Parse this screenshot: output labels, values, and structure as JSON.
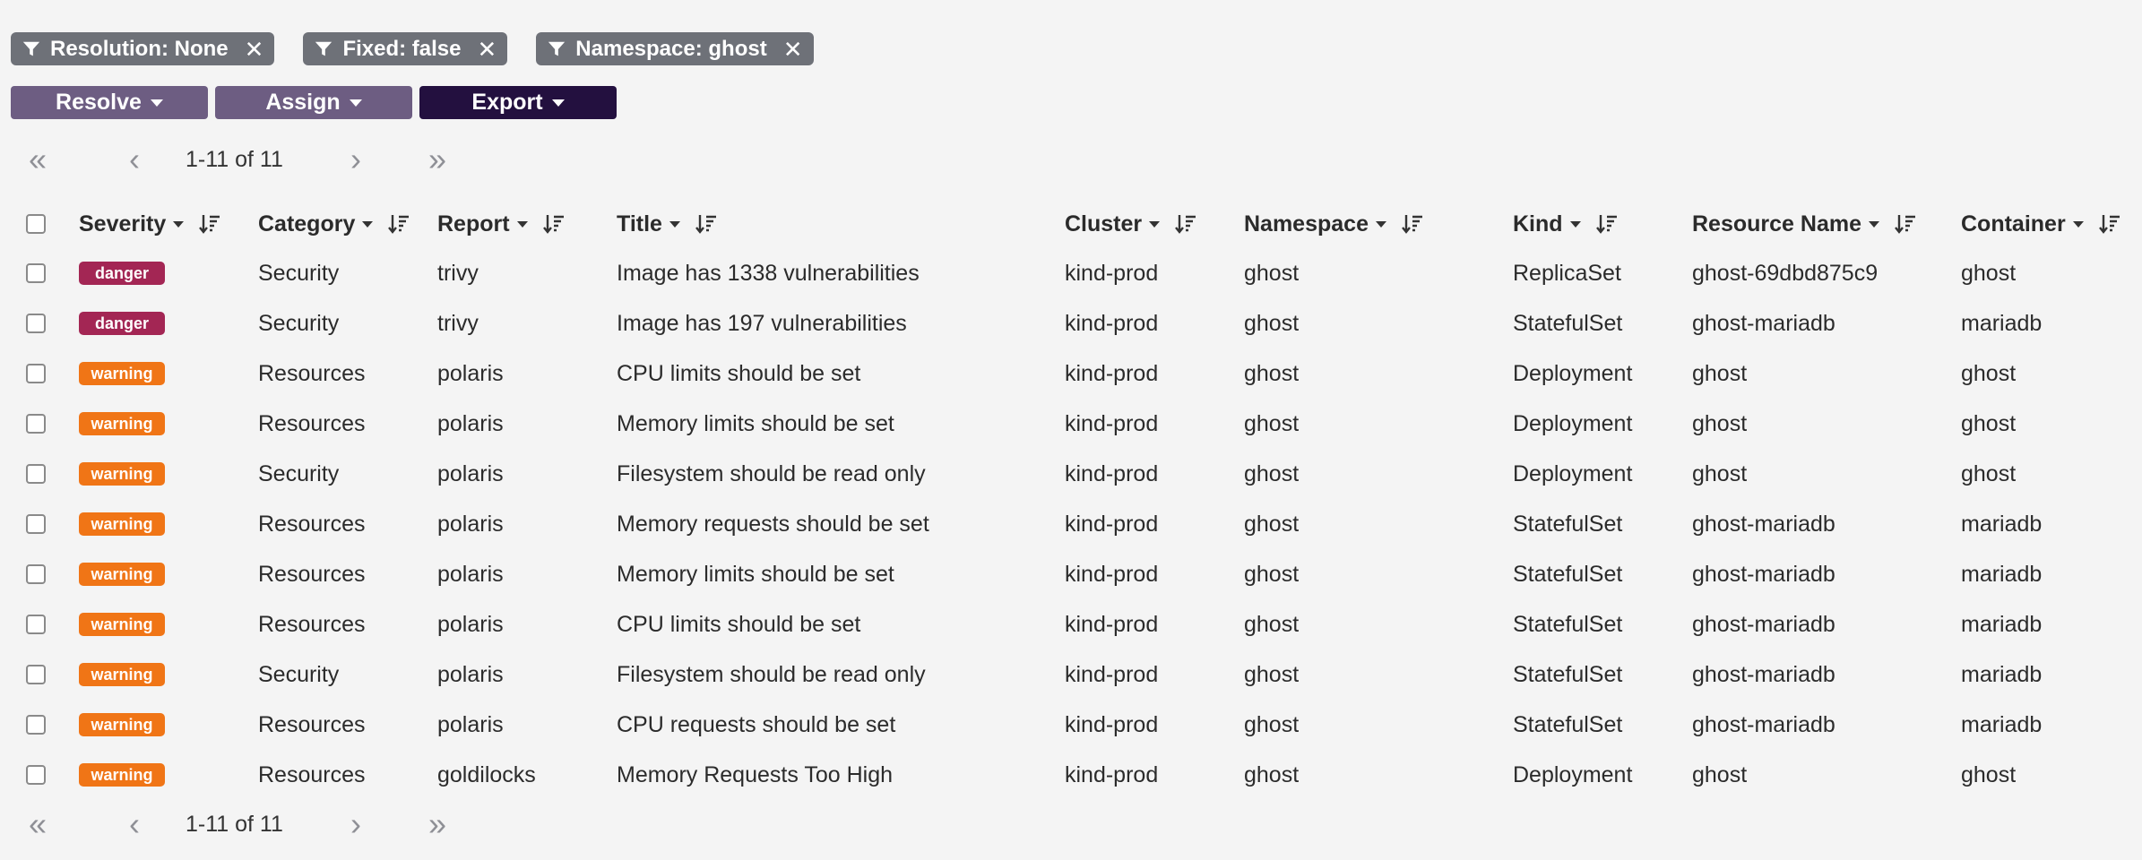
{
  "filters": [
    {
      "label": "Resolution: None"
    },
    {
      "label": "Fixed: false"
    },
    {
      "label": "Namespace: ghost"
    }
  ],
  "actions": {
    "resolve": "Resolve",
    "assign": "Assign",
    "export": "Export"
  },
  "pagination": {
    "range": "1-11 of 11"
  },
  "columns": {
    "severity": "Severity",
    "category": "Category",
    "report": "Report",
    "title": "Title",
    "cluster": "Cluster",
    "namespace": "Namespace",
    "kind": "Kind",
    "resource": "Resource Name",
    "container": "Container"
  },
  "colors": {
    "danger": "#a32654",
    "warning": "#f07516",
    "chip": "#6e7178",
    "button": "#6d5d82",
    "button_dark": "#23103f"
  },
  "rows": [
    {
      "severity": "danger",
      "category": "Security",
      "report": "trivy",
      "title": "Image has 1338 vulnerabilities",
      "cluster": "kind-prod",
      "namespace": "ghost",
      "kind": "ReplicaSet",
      "resource": "ghost-69dbd875c9",
      "container": "ghost"
    },
    {
      "severity": "danger",
      "category": "Security",
      "report": "trivy",
      "title": "Image has 197 vulnerabilities",
      "cluster": "kind-prod",
      "namespace": "ghost",
      "kind": "StatefulSet",
      "resource": "ghost-mariadb",
      "container": "mariadb"
    },
    {
      "severity": "warning",
      "category": "Resources",
      "report": "polaris",
      "title": "CPU limits should be set",
      "cluster": "kind-prod",
      "namespace": "ghost",
      "kind": "Deployment",
      "resource": "ghost",
      "container": "ghost"
    },
    {
      "severity": "warning",
      "category": "Resources",
      "report": "polaris",
      "title": "Memory limits should be set",
      "cluster": "kind-prod",
      "namespace": "ghost",
      "kind": "Deployment",
      "resource": "ghost",
      "container": "ghost"
    },
    {
      "severity": "warning",
      "category": "Security",
      "report": "polaris",
      "title": "Filesystem should be read only",
      "cluster": "kind-prod",
      "namespace": "ghost",
      "kind": "Deployment",
      "resource": "ghost",
      "container": "ghost"
    },
    {
      "severity": "warning",
      "category": "Resources",
      "report": "polaris",
      "title": "Memory requests should be set",
      "cluster": "kind-prod",
      "namespace": "ghost",
      "kind": "StatefulSet",
      "resource": "ghost-mariadb",
      "container": "mariadb"
    },
    {
      "severity": "warning",
      "category": "Resources",
      "report": "polaris",
      "title": "Memory limits should be set",
      "cluster": "kind-prod",
      "namespace": "ghost",
      "kind": "StatefulSet",
      "resource": "ghost-mariadb",
      "container": "mariadb"
    },
    {
      "severity": "warning",
      "category": "Resources",
      "report": "polaris",
      "title": "CPU limits should be set",
      "cluster": "kind-prod",
      "namespace": "ghost",
      "kind": "StatefulSet",
      "resource": "ghost-mariadb",
      "container": "mariadb"
    },
    {
      "severity": "warning",
      "category": "Security",
      "report": "polaris",
      "title": "Filesystem should be read only",
      "cluster": "kind-prod",
      "namespace": "ghost",
      "kind": "StatefulSet",
      "resource": "ghost-mariadb",
      "container": "mariadb"
    },
    {
      "severity": "warning",
      "category": "Resources",
      "report": "polaris",
      "title": "CPU requests should be set",
      "cluster": "kind-prod",
      "namespace": "ghost",
      "kind": "StatefulSet",
      "resource": "ghost-mariadb",
      "container": "mariadb"
    },
    {
      "severity": "warning",
      "category": "Resources",
      "report": "goldilocks",
      "title": "Memory Requests Too High",
      "cluster": "kind-prod",
      "namespace": "ghost",
      "kind": "Deployment",
      "resource": "ghost",
      "container": "ghost"
    }
  ]
}
